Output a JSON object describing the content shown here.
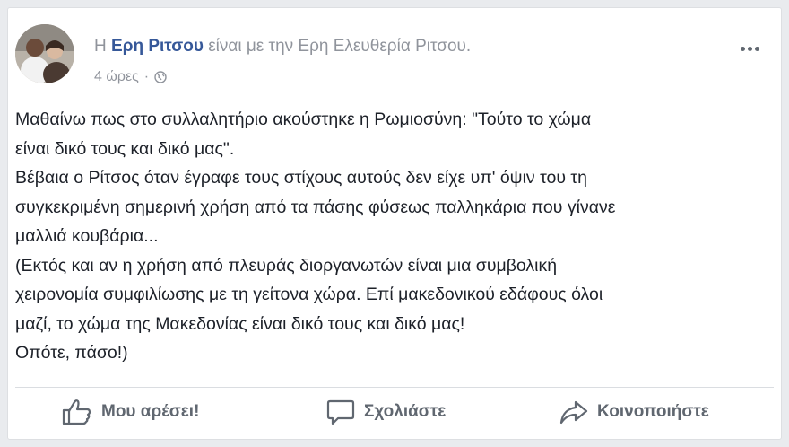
{
  "post": {
    "author_prefix": "Η",
    "author_name": "Ερη Ριτσου",
    "with_text": "είναι με την Ερη Ελευθερία Ριτσου.",
    "timestamp": "4 ώρες",
    "separator": "·",
    "privacy_icon": "globe-icon",
    "body_lines": [
      "Μαθαίνω πως στο συλλαλητήριο ακούστηκε η Ρωμιοσύνη: \"Τούτο το χώμα",
      "είναι δικό τους και δικό μας\".",
      "Βέβαια ο Ρίτσος όταν έγραφε τους στίχους αυτούς δεν είχε υπ' όψιν του τη",
      "συγκεκριμένη σημερινή χρήση από τα πάσης φύσεως παλληκάρια που γίνανε",
      "μαλλιά κουβάρια...",
      "(Εκτός και αν η χρήση από πλευράς διοργανωτών είναι μια συμβολική",
      "χειρονομία συμφιλίωσης με τη γείτονα χώρα. Επί μακεδονικού εδάφους όλοι",
      "μαζί, το χώμα της Μακεδονίας είναι δικό τους και δικό μας!",
      "Οπότε, πάσο!)"
    ]
  },
  "actions": {
    "like_label": "Μου αρέσει!",
    "comment_label": "Σχολιάστε",
    "share_label": "Κοινοποιήστε"
  },
  "colors": {
    "name": "#365899",
    "meta": "#90949c",
    "text": "#1d2129",
    "action": "#606770"
  }
}
